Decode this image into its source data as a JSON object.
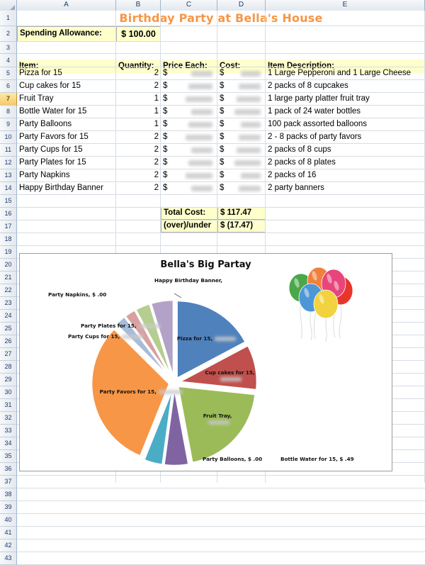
{
  "grid": {
    "columns": [
      "A",
      "B",
      "C",
      "D",
      "E"
    ],
    "active_row": 7,
    "first_row": 1,
    "last_row": 43
  },
  "title": "Birthday Party at Bella's House",
  "allowance": {
    "label": "Spending Allowance:",
    "value": "$ 100.00"
  },
  "table": {
    "headers": [
      "Item:",
      "Quantity:",
      "Price Each:",
      "Cost:",
      "Item Description:"
    ],
    "rows": [
      {
        "row": 5,
        "item": "Pizza for 15",
        "qty": "2",
        "price": "",
        "cost": "",
        "desc": "1 Large Pepperoni and 1 Large Cheese"
      },
      {
        "row": 6,
        "item": "Cup cakes for 15",
        "qty": "2",
        "price": "",
        "cost": "",
        "desc": "2 packs of 8 cupcakes"
      },
      {
        "row": 7,
        "item": "Fruit Tray",
        "qty": "1",
        "price": "",
        "cost": "",
        "desc": "1 large party platter fruit tray"
      },
      {
        "row": 8,
        "item": "Bottle Water for 15",
        "qty": "1",
        "price": "",
        "cost": "",
        "desc": "1 pack of 24 water bottles"
      },
      {
        "row": 9,
        "item": "Party Balloons",
        "qty": "1",
        "price": "",
        "cost": "",
        "desc": "100 pack assorted balloons"
      },
      {
        "row": 10,
        "item": "Party Favors for 15",
        "qty": "2",
        "price": "",
        "cost": "",
        "desc": "2 - 8 packs of party favors"
      },
      {
        "row": 11,
        "item": "Party Cups for 15",
        "qty": "2",
        "price": "",
        "cost": "",
        "desc": "2 packs of 8 cups"
      },
      {
        "row": 12,
        "item": "Party Plates for 15",
        "qty": "2",
        "price": "",
        "cost": "",
        "desc": "2 packs of 8 plates"
      },
      {
        "row": 13,
        "item": "Party Napkins",
        "qty": "2",
        "price": "",
        "cost": "",
        "desc": "2 packs of 16"
      },
      {
        "row": 14,
        "item": "Happy Birthday Banner",
        "qty": "2",
        "price": "",
        "cost": "",
        "desc": "2 party banners"
      }
    ]
  },
  "totals": {
    "total_label": "Total Cost:",
    "total_value": "$   117.47",
    "diff_label": "(over)/under",
    "diff_value": "$   (17.47)"
  },
  "chart_data": {
    "type": "pie",
    "title": "Bella's Big Partay",
    "exploded": true,
    "legend": "none",
    "labels_on_slices": true,
    "categories": [
      "Pizza for 15",
      "Cup cakes for 15",
      "Fruit Tray",
      "Bottle Water for 15",
      "Party Balloons",
      "Party Favors for 15",
      "Party Cups for 15",
      "Party Plates for 15",
      "Party Napkins",
      "Happy Birthday Banner"
    ],
    "values": [
      21.98,
      12.0,
      26.0,
      6.49,
      5.0,
      40.0,
      3.0,
      3.0,
      4.0,
      6.0
    ],
    "value_labels": [
      "Pizza for 15,",
      "Cup cakes for 15,",
      "Fruit Tray,",
      "Bottle Water for 15,  $   .49",
      "Party Balloons,  $  .00",
      "Party Favors for 15,",
      "Party Cups for 15,",
      "Party Plates for 15,",
      "Party Napkins,  $   .00",
      "Happy Birthday Banner,"
    ],
    "colors": [
      "#4f81bd",
      "#c0504d",
      "#9bbb59",
      "#8064a2",
      "#4bacc6",
      "#f79646",
      "#a7bcd9",
      "#d9a0a0",
      "#b5cd8e",
      "#b3a2c7"
    ],
    "total": "117.47"
  },
  "clipart": {
    "name": "balloon-bunch",
    "colors": [
      "#4aa84a",
      "#f0803c",
      "#4e97d6",
      "#e8457a",
      "#f2d23e",
      "#e8352c"
    ]
  }
}
